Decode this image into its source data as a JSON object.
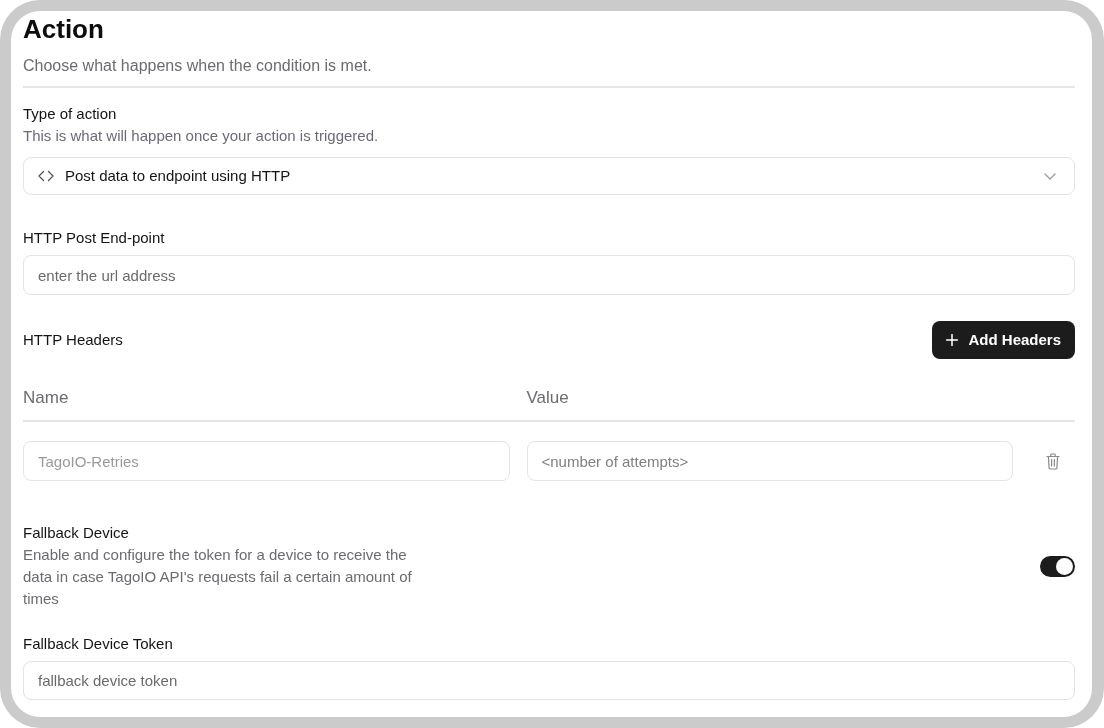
{
  "header": {
    "title": "Action",
    "subtitle": "Choose what happens when the condition is met."
  },
  "action_type": {
    "label": "Type of action",
    "description": "This is what will happen once your action is triggered.",
    "value": "Post data to endpoint using HTTP"
  },
  "endpoint": {
    "label": "HTTP Post End-point",
    "placeholder": "enter the url address"
  },
  "http_headers": {
    "label": "HTTP Headers",
    "add_button": "Add Headers",
    "columns": [
      "Name",
      "Value"
    ],
    "rows": [
      {
        "name": {
          "placeholder": "TagoIO-Retries"
        },
        "value": {
          "placeholder": "<number of attempts>"
        }
      }
    ]
  },
  "fallback_device": {
    "label": "Fallback Device",
    "description": "Enable and configure the token for a device to receive the data in case TagoIO API's requests fail a certain amount of times",
    "on": true
  },
  "fallback_token": {
    "label": "Fallback Device Token",
    "placeholder": "fallback device token"
  }
}
